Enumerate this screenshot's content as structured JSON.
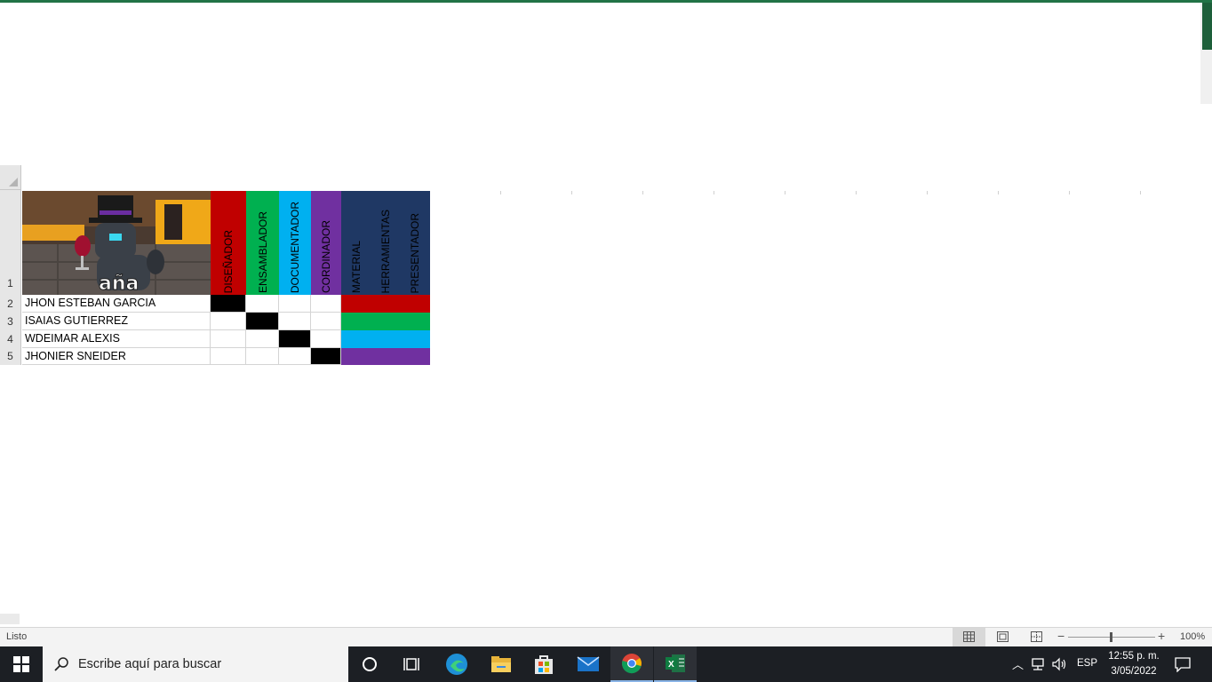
{
  "grid": {
    "row_numbers": [
      "1",
      "2",
      "3",
      "4",
      "5"
    ],
    "header_image_text": "aña",
    "role_headers": [
      "DISEÑADOR",
      "ENSAMBLADOR",
      "DOCUMENTADOR",
      "CORDINADOR",
      "MATERIAL",
      "HERRAMIENTAS",
      "PRESENTADOR"
    ],
    "header_colors": [
      "#c00000",
      "#00b050",
      "#00b0f0",
      "#7030a0",
      "#1f3864",
      "#1f3864",
      "#1f3864"
    ],
    "names": [
      "JHON ESTEBAN GARCIA",
      "ISAIAS GUTIERREZ",
      "WDEIMAR ALEXIS",
      "JHONIER SNEIDER"
    ],
    "row_fill_colors": [
      "#c00000",
      "#00b050",
      "#00b0f0",
      "#7030a0"
    ]
  },
  "status_bar": {
    "status": "Listo",
    "zoom": "100%"
  },
  "taskbar": {
    "search_placeholder": "Escribe aquí para buscar",
    "language": "ESP",
    "time": "12:55 p. m.",
    "date": "3/05/2022",
    "apps": [
      "task-view",
      "widgets",
      "edge",
      "file-explorer",
      "store",
      "mail",
      "chrome",
      "excel"
    ]
  }
}
